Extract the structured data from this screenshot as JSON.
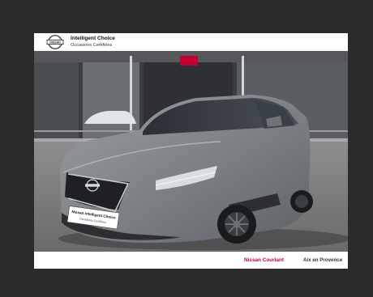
{
  "header": {
    "logo_icon": "nissan-logo-icon",
    "logo_text": "NISSAN",
    "title": "Intelligent Choice",
    "subtitle": "Occasions Certifiées"
  },
  "photo": {
    "subject": "car-photo",
    "plate_line1": "Nissan Intelligent Choice",
    "plate_line2": "Occasions Certifiées",
    "car_color": "#7e8286",
    "accent_color": "#c3002f"
  },
  "footer": {
    "dealer": "Nissan Couriant",
    "city": "Aix en Provence"
  }
}
